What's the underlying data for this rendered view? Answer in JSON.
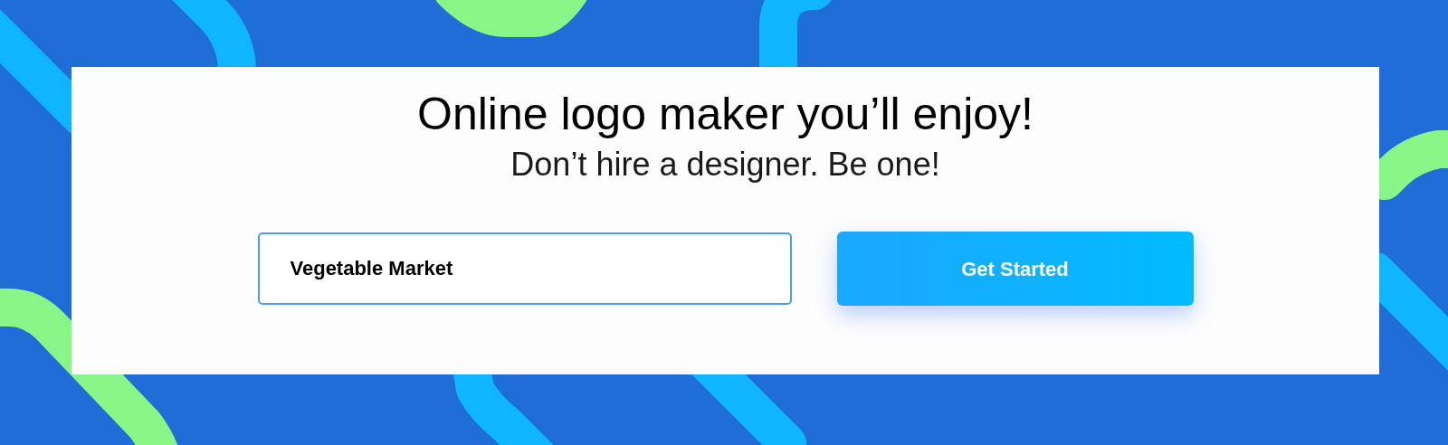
{
  "hero": {
    "title": "Online logo maker you’ll enjoy!",
    "subtitle": "Don’t hire a designer. Be one!"
  },
  "form": {
    "input": {
      "value": "Vegetable Market"
    },
    "button": {
      "label": "Get Started"
    }
  }
}
